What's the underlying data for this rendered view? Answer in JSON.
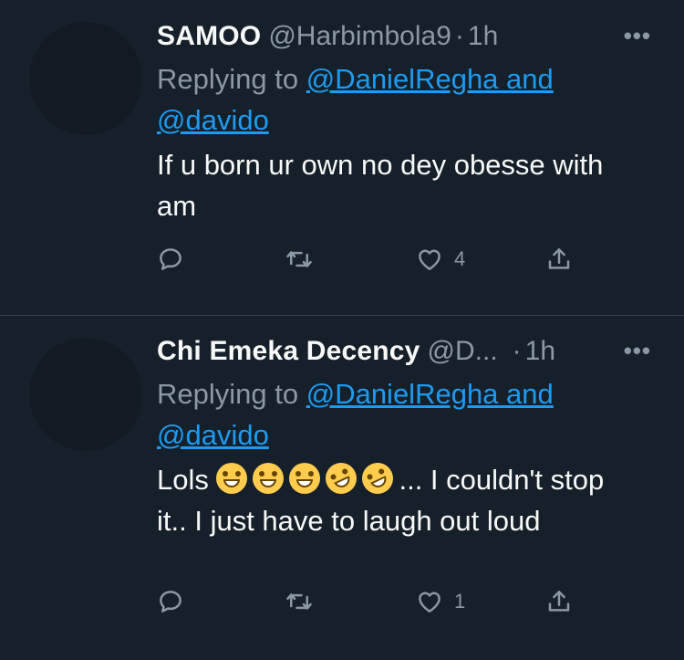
{
  "tweets": [
    {
      "name": "SAMOO",
      "handle": "@Harbimbola9",
      "sep": "·",
      "time": "1h",
      "more": "•••",
      "replying_prefix": "Replying to ",
      "mention_line1": "@DanielRegha and",
      "mention_line2": "@davido",
      "text": "If u born ur own no dey obesse with am",
      "actions": {
        "reply_icon": "reply-icon",
        "retweet_icon": "retweet-icon",
        "like_icon": "heart-icon",
        "like_count": "4",
        "share_icon": "share-icon"
      }
    },
    {
      "name": "Chi Emeka Decency",
      "handle": "@D...",
      "sep": "·",
      "time": "1h",
      "more": "•••",
      "replying_prefix": "Replying to ",
      "mention_line1": "@DanielRegha and",
      "mention_line2": "@davido",
      "text_start": "Lols ",
      "text_rest": "... I couldn't stop it.. I just have to laugh out loud",
      "emojis": [
        "grinning-face",
        "grinning-face",
        "grinning-face",
        "rolling-on-floor-laughing",
        "rolling-on-floor-laughing"
      ],
      "actions": {
        "reply_icon": "reply-icon",
        "retweet_icon": "retweet-icon",
        "like_icon": "heart-icon",
        "like_count": "1",
        "share_icon": "share-icon"
      }
    }
  ],
  "colors": {
    "background": "#15202b",
    "mention": "#1d9bf0",
    "secondary_text": "#8b98a5",
    "divider": "#38444d"
  }
}
